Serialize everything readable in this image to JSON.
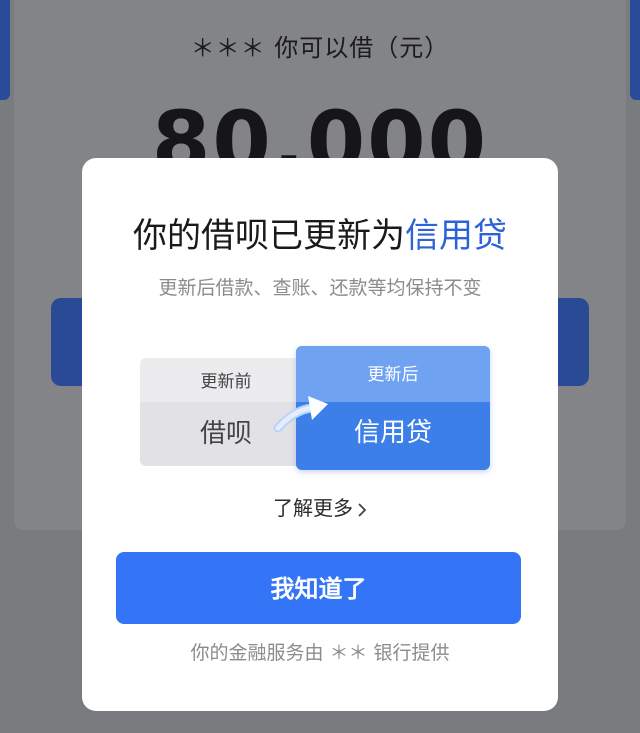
{
  "background": {
    "limit_label": "＊＊＊ 你可以借（元）",
    "limit_amount": "80,000"
  },
  "modal": {
    "title_prefix": "你的借呗已更新为",
    "title_highlight": "信用贷",
    "subtitle": "更新后借款、查账、还款等均保持不变",
    "before": {
      "head": "更新前",
      "name": "借呗"
    },
    "after": {
      "head": "更新后",
      "name": "信用贷"
    },
    "learn_more": "了解更多",
    "confirm_label": "我知道了",
    "footer_note": "你的金融服务由 ＊＊ 银行提供"
  },
  "colors": {
    "accent": "#3474f6",
    "highlight_text": "#2d63d6",
    "overlay": "#7b7c80"
  },
  "icons": {
    "arrow": "curved-arrow-icon",
    "chevron": "chevron-right-icon"
  }
}
